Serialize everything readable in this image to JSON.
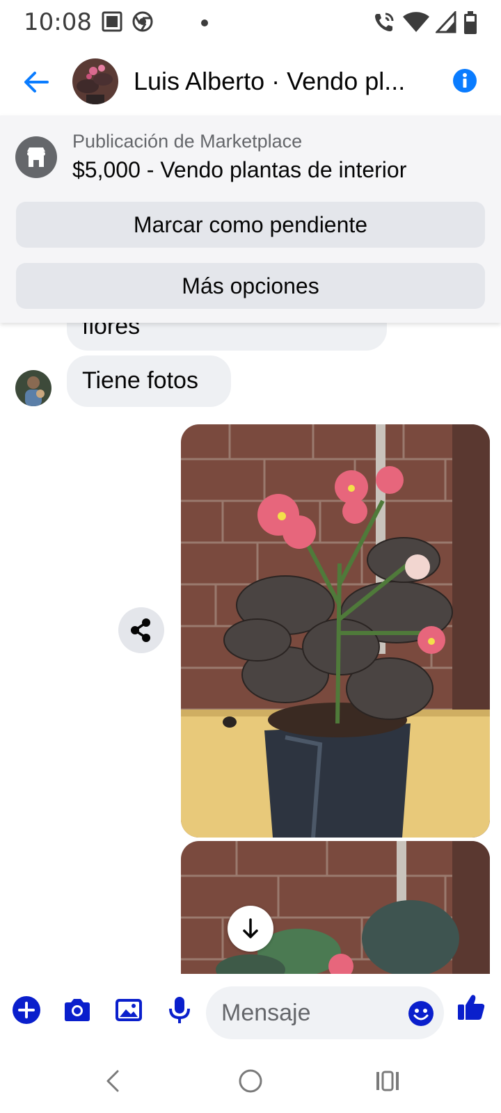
{
  "status_bar": {
    "time": "10:08"
  },
  "header": {
    "title": "Luis Alberto · Vendo pl..."
  },
  "listing": {
    "subtitle": "Publicación de Marketplace",
    "title": "$5,000 - Vendo plantas de interior",
    "pending_button": "Marcar como pendiente",
    "more_button": "Más opciones"
  },
  "messages": [
    {
      "text": "flores"
    },
    {
      "text": "Tiene fotos"
    }
  ],
  "composer": {
    "placeholder": "Mensaje"
  },
  "colors": {
    "accent": "#0a7cff",
    "composer_icon": "#0a1fcc",
    "bubble": "#eef0f3"
  }
}
